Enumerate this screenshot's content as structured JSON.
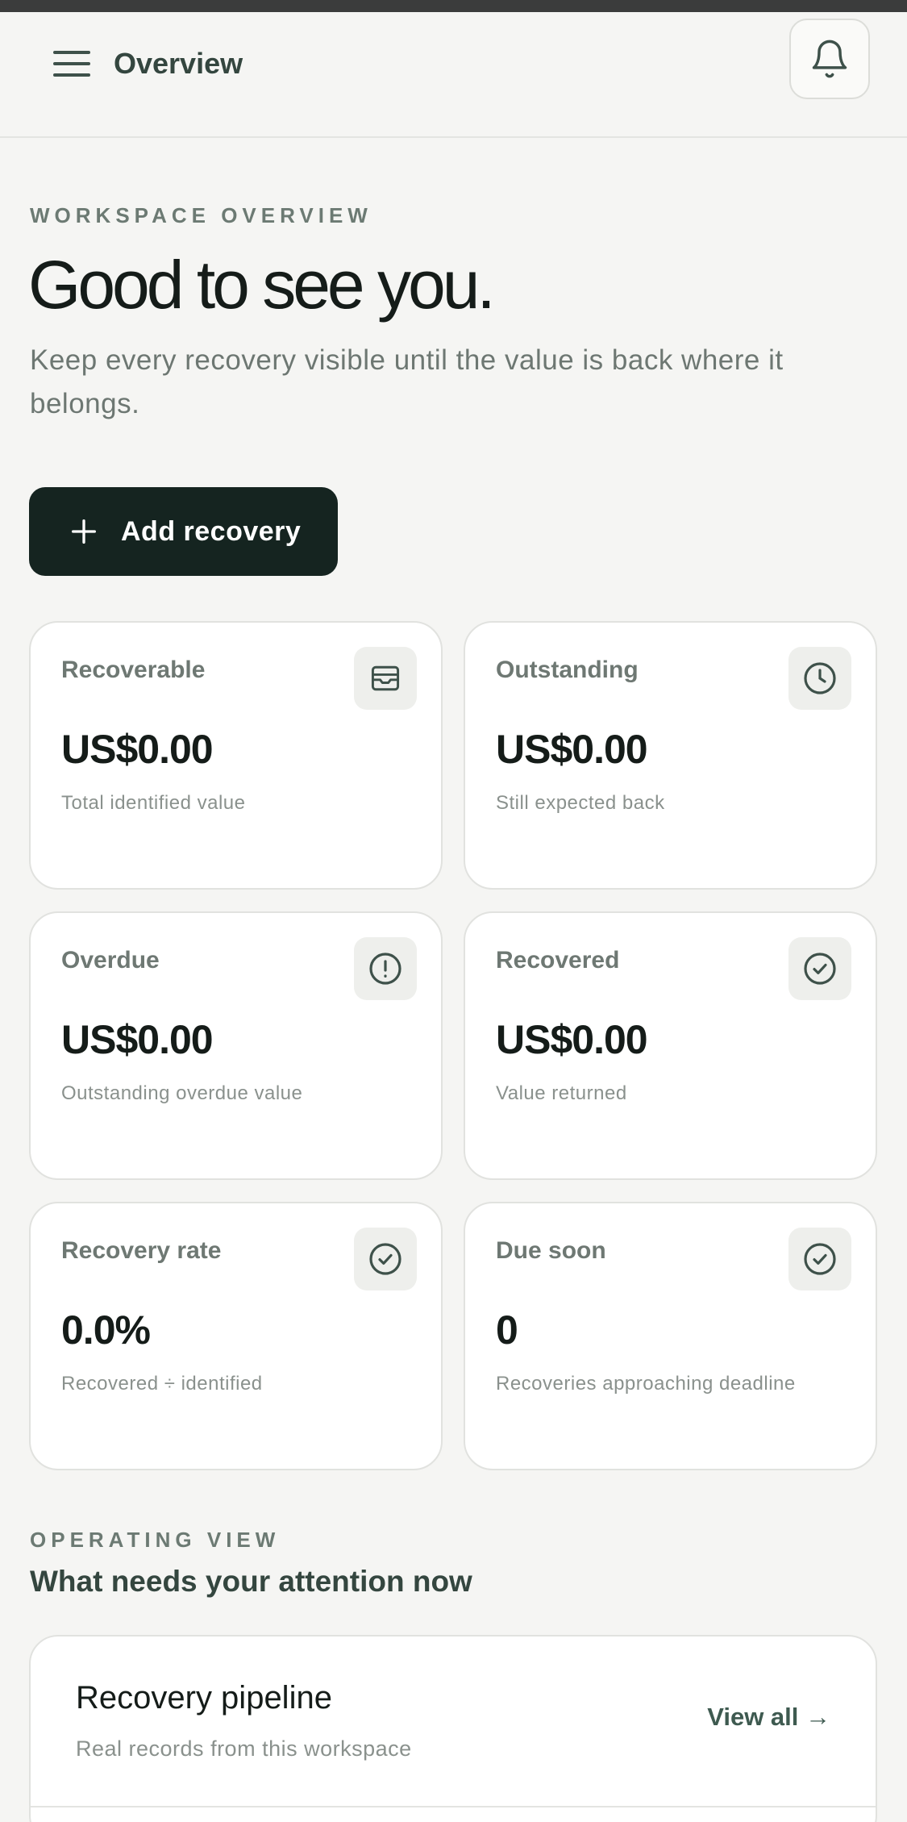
{
  "header": {
    "title": "Overview",
    "menu_icon": "menu-icon",
    "bell_icon": "bell-icon"
  },
  "hero": {
    "eyebrow": "WORKSPACE OVERVIEW",
    "title": "Good to see you.",
    "subtitle": "Keep every recovery visible until the value is back where it belongs.",
    "add_button_label": "Add recovery"
  },
  "cards": [
    {
      "label": "Recoverable",
      "value": "US$0.00",
      "desc": "Total identified value",
      "icon": "wallet-icon"
    },
    {
      "label": "Outstanding",
      "value": "US$0.00",
      "desc": "Still expected back",
      "icon": "clock-icon"
    },
    {
      "label": "Overdue",
      "value": "US$0.00",
      "desc": "Outstanding overdue value",
      "icon": "alert-icon"
    },
    {
      "label": "Recovered",
      "value": "US$0.00",
      "desc": "Value returned",
      "icon": "check-circle-icon"
    },
    {
      "label": "Recovery rate",
      "value": "0.0%",
      "desc": "Recovered ÷ identified",
      "icon": "check-circle-icon"
    },
    {
      "label": "Due soon",
      "value": "0",
      "desc": "Recoveries approaching deadline",
      "icon": "check-circle-icon"
    }
  ],
  "operating": {
    "eyebrow": "OPERATING VIEW",
    "title": "What needs your attention now"
  },
  "pipeline": {
    "title": "Recovery pipeline",
    "subtitle": "Real records from this workspace",
    "link_label": "View all →"
  },
  "colors": {
    "background": "#f5f5f3",
    "primary_button": "#152420",
    "accent_text": "#3e5a50",
    "muted_text": "#6e7873"
  }
}
